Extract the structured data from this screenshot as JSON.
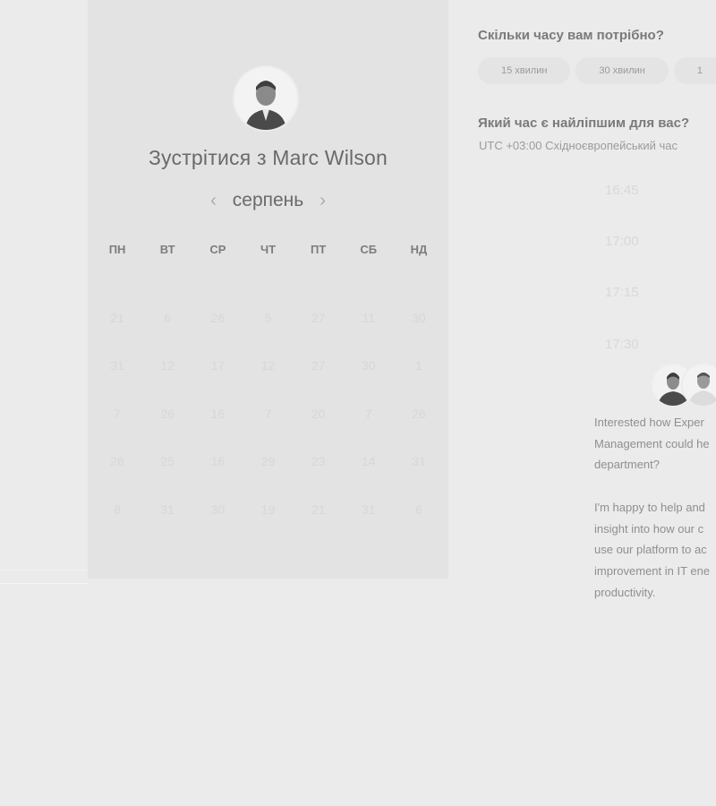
{
  "booking": {
    "title": "Зустрітися з Marc Wilson",
    "month": "серпень",
    "weekdays": [
      "ПН",
      "ВТ",
      "СР",
      "ЧТ",
      "ПТ",
      "СБ",
      "НД"
    ],
    "weeks": [
      [
        "21",
        "6",
        "26",
        "5",
        "27",
        "11",
        "30"
      ],
      [
        "31",
        "12",
        "17",
        "12",
        "27",
        "30",
        "1"
      ],
      [
        "7",
        "26",
        "16",
        "7",
        "20",
        "7",
        "26"
      ],
      [
        "26",
        "25",
        "16",
        "29",
        "23",
        "14",
        "31"
      ],
      [
        "8",
        "31",
        "30",
        "19",
        "21",
        "31",
        "6"
      ]
    ]
  },
  "duration": {
    "question": "Скільки часу вам потрібно?",
    "options": [
      "15 хвилин",
      "30 хвилин",
      "1"
    ]
  },
  "time": {
    "question": "Який час є найліпшим для вас?",
    "timezone": "UTC +03:00 Східноєвропейський час",
    "slots": [
      "16:45",
      "17:00",
      "17:15",
      "17:30"
    ]
  },
  "description": {
    "lines1": [
      "Interested how Exper",
      "Management could he",
      "department?"
    ],
    "lines2": [
      "I'm happy to help and",
      "insight into how our c",
      "use our platform to ac",
      "improvement in IT ene",
      "productivity."
    ]
  },
  "colors": {
    "background": "#ebebeb",
    "panel": "#e3e3e3",
    "text": "#6f6f6f",
    "muted_date": "#d7d7d7"
  }
}
